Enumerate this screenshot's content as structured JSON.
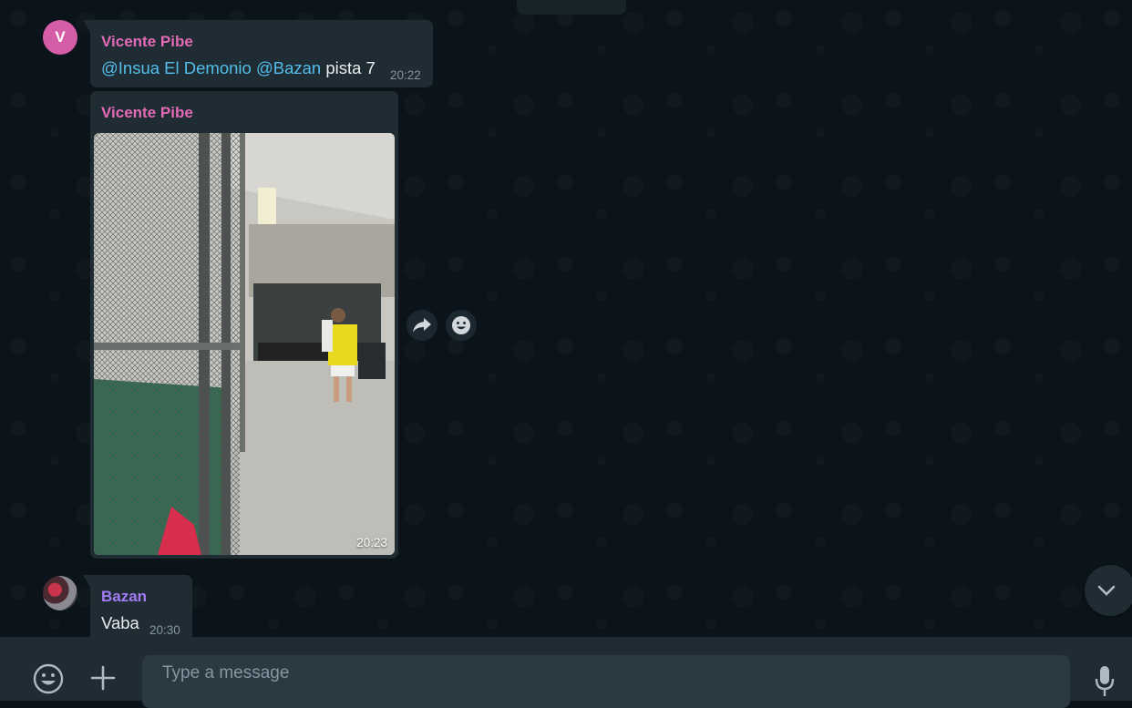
{
  "messages": [
    {
      "sender": "Vicente Pibe",
      "avatar_initial": "V",
      "mention_1": "@Insua El Demonio",
      "mention_2": "@Bazan",
      "text": "pista 7",
      "time": "20:22"
    },
    {
      "sender": "Vicente Pibe",
      "type": "image",
      "time": "20:23",
      "image_alt": "Photo: padel court with players"
    },
    {
      "sender": "Bazan",
      "text": "Vaba",
      "time": "20:30"
    }
  ],
  "hover_actions": {
    "forward_icon": "forward-icon",
    "react_icon": "emoji-react-icon"
  },
  "composer": {
    "placeholder": "Type a message",
    "emoji_icon": "emoji-icon",
    "attach_icon": "plus-icon",
    "mic_icon": "mic-icon"
  },
  "scroll_button_icon": "chevron-down-icon",
  "colors": {
    "background": "#0b141a",
    "bubble": "#202c33",
    "sender_pink": "#e26ab6",
    "sender_purple": "#a17cf3",
    "mention": "#53bdeb",
    "avatar_v": "#d55ca6"
  }
}
